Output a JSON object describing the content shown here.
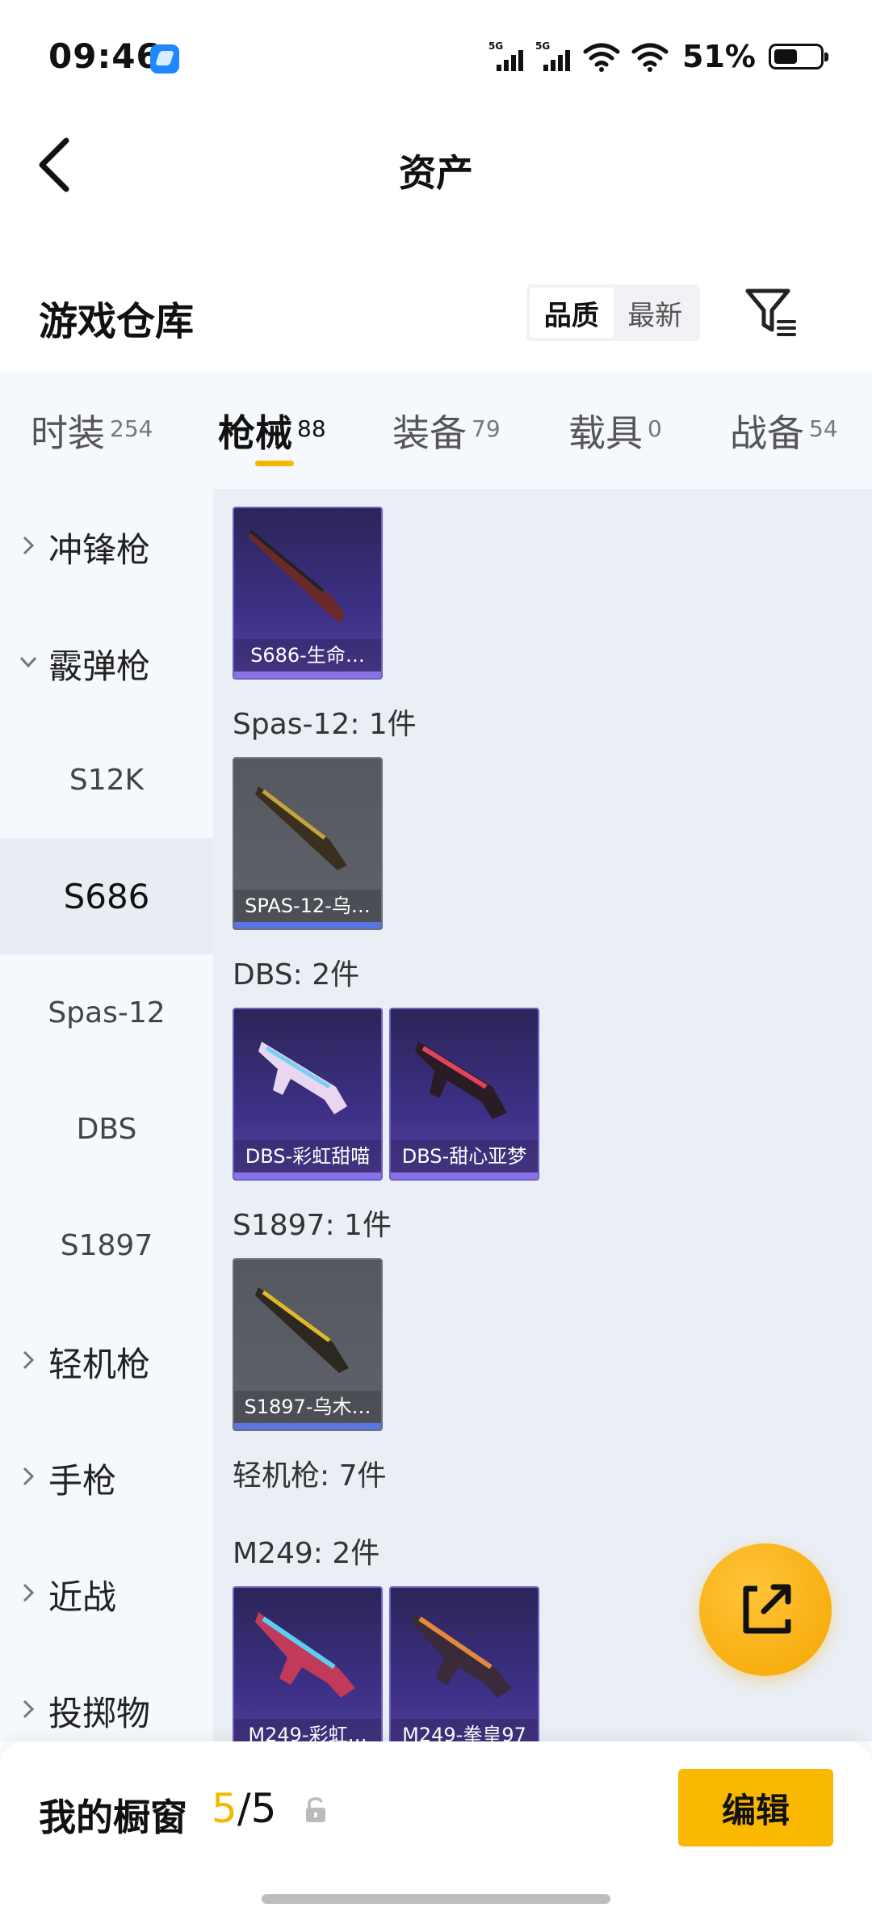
{
  "status_bar": {
    "time": "09:46",
    "signal1_label": "5G",
    "signal2_label": "5G",
    "battery_percent": "51%"
  },
  "nav": {
    "title": "资产"
  },
  "section": {
    "title": "游戏仓库",
    "sort_options": [
      "品质",
      "最新"
    ],
    "active_sort": "品质"
  },
  "tabs": [
    {
      "name": "时装",
      "count": "254"
    },
    {
      "name": "枪械",
      "count": "88"
    },
    {
      "name": "装备",
      "count": "79"
    },
    {
      "name": "载具",
      "count": "0"
    },
    {
      "name": "战备",
      "count": "54"
    }
  ],
  "active_tab": "枪械",
  "sidebar": {
    "items": [
      {
        "label": "冲锋枪",
        "type": "category",
        "expanded": false
      },
      {
        "label": "霰弹枪",
        "type": "category",
        "expanded": true
      },
      {
        "label": "S12K",
        "type": "sub"
      },
      {
        "label": "S686",
        "type": "sub",
        "selected": true
      },
      {
        "label": "Spas-12",
        "type": "sub"
      },
      {
        "label": "DBS",
        "type": "sub"
      },
      {
        "label": "S1897",
        "type": "sub"
      },
      {
        "label": "轻机枪",
        "type": "category",
        "expanded": false
      },
      {
        "label": "手枪",
        "type": "category",
        "expanded": false
      },
      {
        "label": "近战",
        "type": "category",
        "expanded": false
      },
      {
        "label": "投掷物",
        "type": "category",
        "expanded": false
      }
    ]
  },
  "content": {
    "groups": [
      {
        "label": "",
        "cards": [
          {
            "caption": "S686-生命…",
            "style": "purple"
          }
        ]
      },
      {
        "label": "Spas-12: 1件",
        "cards": [
          {
            "caption": "SPAS-12-乌…",
            "style": "grey"
          }
        ]
      },
      {
        "label": "DBS: 2件",
        "cards": [
          {
            "caption": "DBS-彩虹甜喵",
            "style": "purple"
          },
          {
            "caption": "DBS-甜心亚梦",
            "style": "purple"
          }
        ]
      },
      {
        "label": "S1897: 1件",
        "cards": [
          {
            "caption": "S1897-乌木…",
            "style": "grey"
          }
        ]
      },
      {
        "label": "轻机枪: 7件",
        "cards": []
      },
      {
        "label": "M249: 2件",
        "cards": [
          {
            "caption": "M249-彩虹…",
            "style": "purple"
          },
          {
            "caption": "M249-拳皇97",
            "style": "purple"
          }
        ]
      }
    ]
  },
  "bottom": {
    "showcase_label": "我的橱窗",
    "showcase_current": "5",
    "showcase_sep": "/",
    "showcase_total": "5",
    "edit_label": "编辑"
  },
  "colors": {
    "accent": "#f5b800",
    "card_purple": "#3d3086",
    "card_grey": "#5f626a"
  }
}
